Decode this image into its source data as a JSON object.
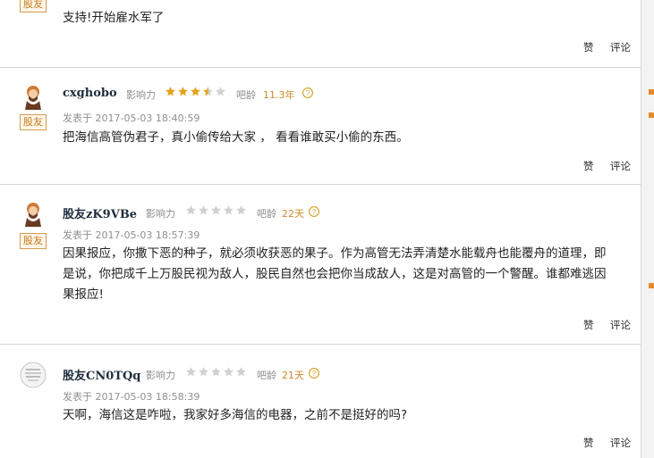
{
  "labels": {
    "badge": "股友",
    "influence": "影响力",
    "age": "吧龄",
    "like": "赞",
    "reply": "评论"
  },
  "comments": [
    {
      "text": "支持!开始雇水军了",
      "partial": true
    },
    {
      "username": "cxghobo",
      "rating": 3.5,
      "age": "11.3年",
      "time": "发表于 2017-05-03 18:40:59",
      "text": "把海信高管伪君子，真小偷传给大家 ， 看看谁敢买小偷的东西。",
      "avatar": "bearded-avatar-icon"
    },
    {
      "username": "股友zK9VBe",
      "rating": 0,
      "age": "22天",
      "time": "发表于 2017-05-03 18:57:39",
      "text": "因果报应，你撒下恶的种子，就必须收获恶的果子。作为高管无法弄清楚水能载舟也能覆舟的道理，即\n是说，你把成千上万股民视为敌人，股民自然也会把你当成敌人，这是对高管的一个警醒。谁都难逃因\n果报应!",
      "avatar": "bearded-avatar-icon"
    },
    {
      "username": "股友CN0TQq",
      "rating": 0,
      "age": "21天",
      "time": "发表于 2017-05-03 18:58:39",
      "text": "天啊，海信这是咋啦，我家好多海信的电器，之前不是挺好的吗?",
      "avatar": "gray-avatar-icon"
    }
  ],
  "colors": {
    "badge": "#c67a1a",
    "star_active": "#e6a11d",
    "star_inactive": "#d0d0d0",
    "age": "#cf8a2c"
  }
}
